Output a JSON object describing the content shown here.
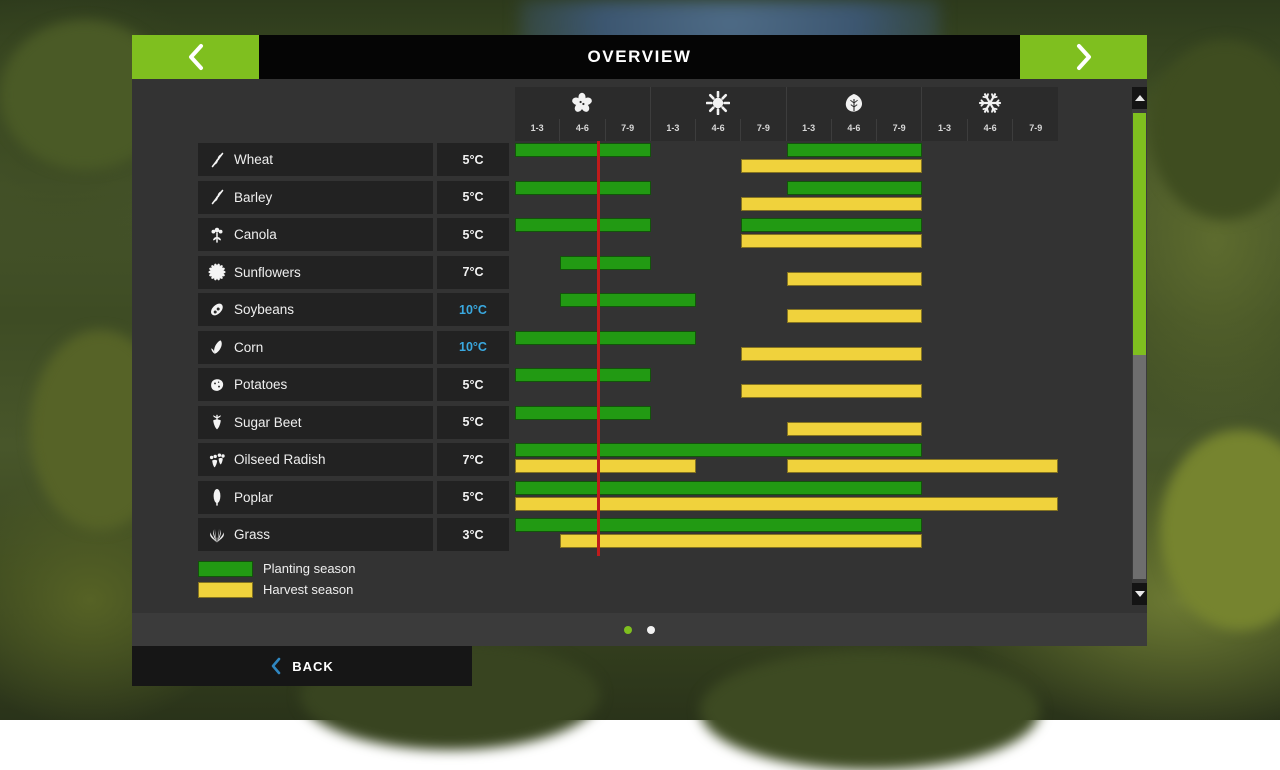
{
  "header": {
    "title": "OVERVIEW",
    "prev_icon": "chevron-left-icon",
    "next_icon": "chevron-right-icon"
  },
  "seasons": [
    {
      "name": "spring",
      "icon": "spring-blossom-icon",
      "periods": [
        "1-3",
        "4-6",
        "7-9"
      ]
    },
    {
      "name": "summer",
      "icon": "sun-icon",
      "periods": [
        "1-3",
        "4-6",
        "7-9"
      ]
    },
    {
      "name": "autumn",
      "icon": "autumn-leaf-icon",
      "periods": [
        "1-3",
        "4-6",
        "7-9"
      ]
    },
    {
      "name": "winter",
      "icon": "snowflake-icon",
      "periods": [
        "1-3",
        "4-6",
        "7-9"
      ]
    }
  ],
  "legend": [
    {
      "label": "Planting season",
      "color": "#229a13"
    },
    {
      "label": "Harvest season",
      "color": "#f0d23c"
    }
  ],
  "colors": {
    "planting": "#229a13",
    "harvest": "#f0d23c",
    "accent_green": "#7fbf1f",
    "highlight_blue": "#3aa9e0",
    "time_marker": "#c01b1b"
  },
  "chart_data": {
    "type": "bar",
    "title": "OVERVIEW",
    "xlabel": "",
    "ylabel": "",
    "x_axis": {
      "unit": "period",
      "total_periods": 12,
      "tick_labels": [
        "1-3",
        "4-6",
        "7-9",
        "1-3",
        "4-6",
        "7-9",
        "1-3",
        "4-6",
        "7-9",
        "1-3",
        "4-6",
        "7-9"
      ],
      "group_labels": [
        "spring",
        "summer",
        "autumn",
        "winter"
      ]
    },
    "current_period_marker": 2,
    "series": [
      {
        "name": "Planting season",
        "color": "#229a13"
      },
      {
        "name": "Harvest season",
        "color": "#f0d23c"
      }
    ],
    "rows": [
      {
        "crop": "Wheat",
        "icon": "wheat-icon",
        "temperature": "5°C",
        "temp_highlight": false,
        "planting": [
          [
            0,
            3
          ],
          [
            6,
            9
          ]
        ],
        "harvest": [
          [
            5,
            9
          ]
        ]
      },
      {
        "crop": "Barley",
        "icon": "barley-icon",
        "temperature": "5°C",
        "temp_highlight": false,
        "planting": [
          [
            0,
            3
          ],
          [
            6,
            9
          ]
        ],
        "harvest": [
          [
            5,
            9
          ]
        ]
      },
      {
        "crop": "Canola",
        "icon": "canola-icon",
        "temperature": "5°C",
        "temp_highlight": false,
        "planting": [
          [
            0,
            3
          ],
          [
            5,
            9
          ]
        ],
        "harvest": [
          [
            5,
            9
          ]
        ]
      },
      {
        "crop": "Sunflowers",
        "icon": "sunflower-icon",
        "temperature": "7°C",
        "temp_highlight": false,
        "planting": [
          [
            1,
            3
          ]
        ],
        "harvest": [
          [
            6,
            9
          ]
        ]
      },
      {
        "crop": "Soybeans",
        "icon": "soybean-icon",
        "temperature": "10°C",
        "temp_highlight": true,
        "planting": [
          [
            1,
            4
          ]
        ],
        "harvest": [
          [
            6,
            9
          ]
        ]
      },
      {
        "crop": "Corn",
        "icon": "corn-icon",
        "temperature": "10°C",
        "temp_highlight": true,
        "planting": [
          [
            0,
            4
          ]
        ],
        "harvest": [
          [
            5,
            9
          ]
        ]
      },
      {
        "crop": "Potatoes",
        "icon": "potato-icon",
        "temperature": "5°C",
        "temp_highlight": false,
        "planting": [
          [
            0,
            3
          ]
        ],
        "harvest": [
          [
            5,
            9
          ]
        ]
      },
      {
        "crop": "Sugar Beet",
        "icon": "sugarbeet-icon",
        "temperature": "5°C",
        "temp_highlight": false,
        "planting": [
          [
            0,
            3
          ]
        ],
        "harvest": [
          [
            6,
            9
          ]
        ]
      },
      {
        "crop": "Oilseed Radish",
        "icon": "oilseed-radish-icon",
        "temperature": "7°C",
        "temp_highlight": false,
        "planting": [
          [
            0,
            9
          ]
        ],
        "harvest": [
          [
            0,
            4
          ],
          [
            6,
            12
          ]
        ]
      },
      {
        "crop": "Poplar",
        "icon": "poplar-icon",
        "temperature": "5°C",
        "temp_highlight": false,
        "planting": [
          [
            0,
            9
          ]
        ],
        "harvest": [
          [
            0,
            12
          ]
        ]
      },
      {
        "crop": "Grass",
        "icon": "grass-icon",
        "temperature": "3°C",
        "temp_highlight": false,
        "planting": [
          [
            0,
            9
          ]
        ],
        "harvest": [
          [
            1,
            9
          ]
        ]
      }
    ]
  },
  "pagination": {
    "dots": [
      {
        "state": "active"
      },
      {
        "state": "idle"
      }
    ]
  },
  "footer": {
    "back_label": "BACK",
    "back_icon": "chevron-left-icon"
  },
  "scrollbar": {
    "up_icon": "triangle-up-icon",
    "down_icon": "triangle-down-icon",
    "thumb_position": 0,
    "thumb_size_pct": 52
  }
}
